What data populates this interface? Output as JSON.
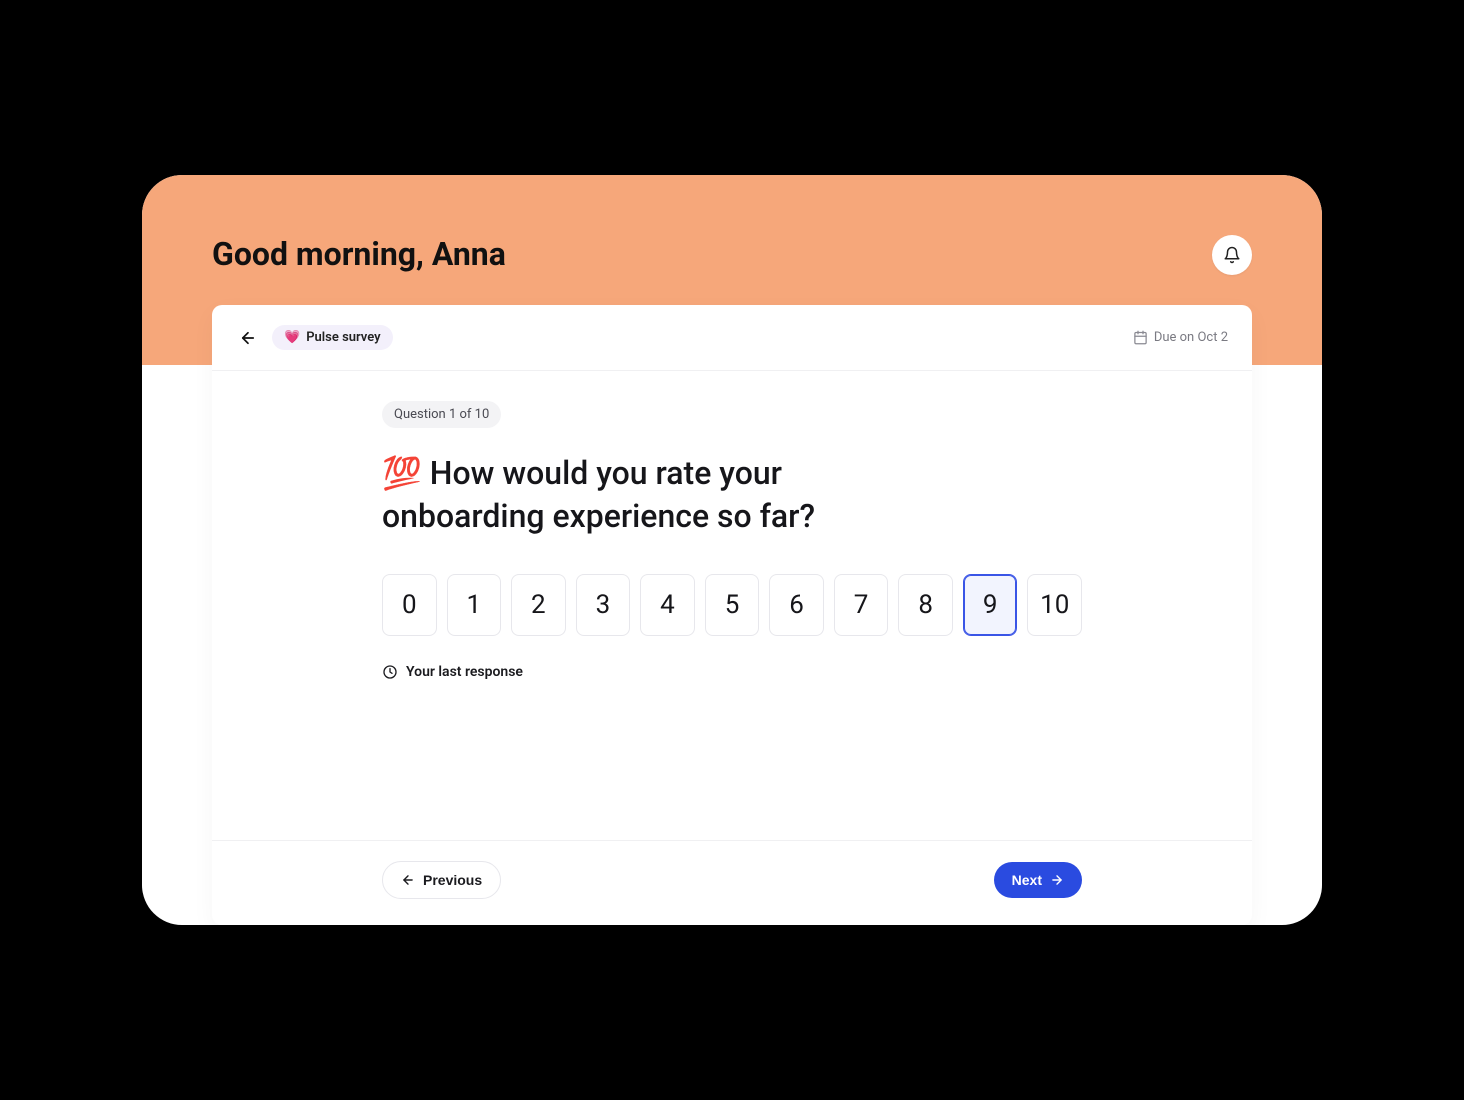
{
  "header": {
    "greeting": "Good morning, Anna"
  },
  "survey": {
    "pill_icon": "💗",
    "pill_label": "Pulse survey",
    "due_label": "Due on Oct 2",
    "question_badge": "Question 1 of 10",
    "question_icon": "💯",
    "question_text": "How would you rate your onboarding experience so far?",
    "scale": [
      "0",
      "1",
      "2",
      "3",
      "4",
      "5",
      "6",
      "7",
      "8",
      "9",
      "10"
    ],
    "selected_value": "9",
    "last_response_label": "Your last response"
  },
  "footer": {
    "prev_label": "Previous",
    "next_label": "Next"
  }
}
